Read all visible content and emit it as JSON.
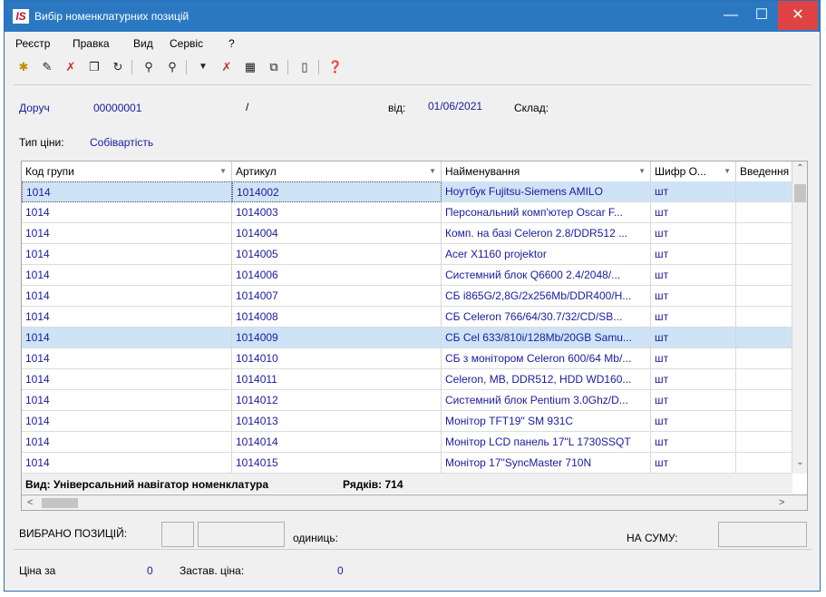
{
  "window": {
    "logo_text": "IS",
    "title": "Вибір номенклатурних позицій",
    "min_glyph": "—",
    "max_glyph": "☐",
    "close_glyph": "✕"
  },
  "menu": [
    "Реєстр",
    "Правка",
    "Вид",
    "Сервіс",
    "?"
  ],
  "toolbar": [
    {
      "icon": "new-icon",
      "glyph": "✱"
    },
    {
      "icon": "edit-icon",
      "glyph": "✎"
    },
    {
      "icon": "delete-icon",
      "glyph": "✗"
    },
    {
      "icon": "copy-icon",
      "glyph": "❐"
    },
    {
      "icon": "refresh-icon",
      "glyph": "↻"
    },
    {
      "icon": "search-icon",
      "glyph": "⚲"
    },
    {
      "icon": "search-next-icon",
      "glyph": "⚲"
    },
    {
      "icon": "filter-icon",
      "glyph": "▼"
    },
    {
      "icon": "clear-filter-icon",
      "glyph": "✗"
    },
    {
      "icon": "table-icon",
      "glyph": "▦"
    },
    {
      "icon": "view-icon",
      "glyph": "⧉"
    },
    {
      "icon": "document-icon",
      "glyph": "▯"
    },
    {
      "icon": "help-icon",
      "glyph": "❓"
    }
  ],
  "header": {
    "doc_label": "Доруч",
    "doc_number": "00000001",
    "slash": "/",
    "from_label": "від:",
    "date": "01/06/2021",
    "warehouse_label": "Склад:",
    "price_type_label": "Тип ціни:",
    "price_type_value": "Собівартість"
  },
  "grid": {
    "columns": [
      "Код групи",
      "Артикул",
      "Найменування",
      "Шифр О...",
      "Введення"
    ],
    "rows": [
      {
        "group": "1014",
        "article": "1014002",
        "name": "Ноутбук Fujitsu-Siemens AMILO",
        "unit": "шт"
      },
      {
        "group": "1014",
        "article": "1014003",
        "name": "Персональний комп'ютер Oscar F...",
        "unit": "шт"
      },
      {
        "group": "1014",
        "article": "1014004",
        "name": "Комп. на базі Celeron 2.8/DDR512 ...",
        "unit": "шт"
      },
      {
        "group": "1014",
        "article": "1014005",
        "name": "Acer X1160 projektor",
        "unit": "шт"
      },
      {
        "group": "1014",
        "article": "1014006",
        "name": "Системний блок Q6600 2.4/2048/...",
        "unit": "шт"
      },
      {
        "group": "1014",
        "article": "1014007",
        "name": "СБ i865G/2,8G/2x256Mb/DDR400/H...",
        "unit": "шт"
      },
      {
        "group": "1014",
        "article": "1014008",
        "name": "СБ Celeron 766/64/30.7/32/CD/SB...",
        "unit": "шт"
      },
      {
        "group": "1014",
        "article": "1014009",
        "name": "СБ Cel 633/810i/128Mb/20GB Samu...",
        "unit": "шт"
      },
      {
        "group": "1014",
        "article": "1014010",
        "name": "СБ з монітором Celeron 600/64 Mb/...",
        "unit": "шт"
      },
      {
        "group": "1014",
        "article": "1014011",
        "name": "Celeron, MB, DDR512, HDD WD160...",
        "unit": "шт"
      },
      {
        "group": "1014",
        "article": "1014012",
        "name": "Системний блок Pentium 3.0Ghz/D...",
        "unit": "шт"
      },
      {
        "group": "1014",
        "article": "1014013",
        "name": "Монітор TFT19\" SM 931C",
        "unit": "шт"
      },
      {
        "group": "1014",
        "article": "1014014",
        "name": "Монітор LCD панель 17\"L 1730SSQT",
        "unit": "шт"
      },
      {
        "group": "1014",
        "article": "1014015",
        "name": "Монітор 17\"SyncMaster 710N",
        "unit": "шт"
      }
    ],
    "status_view": "Вид: Універсальний навігатор номенклатура",
    "status_rows": "Рядків: 714",
    "sort_glyph": "▼",
    "up_glyph": "⌃",
    "down_glyph": "⌄",
    "left_glyph": "<",
    "right_glyph": ">"
  },
  "footer": {
    "selected_label": "ВИБРАНО ПОЗИЦІЙ:",
    "units_label": "одиниць:",
    "sum_label": "НА СУМУ:",
    "price_label": "Ціна за",
    "price_value": "0",
    "deposit_label": "Застав. ціна:",
    "deposit_value": "0"
  }
}
